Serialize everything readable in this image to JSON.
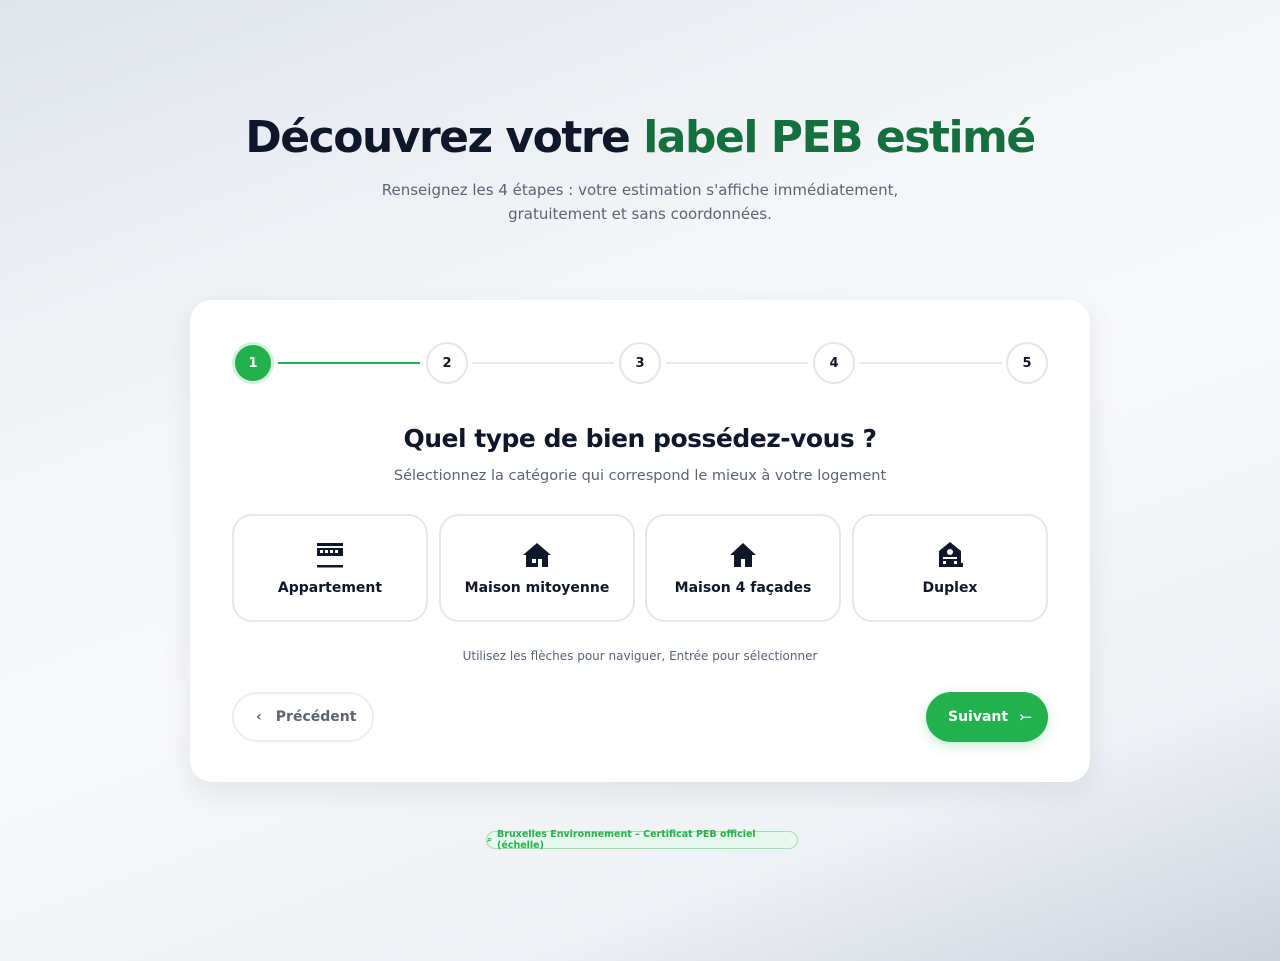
{
  "hero": {
    "title_main": "Découvrez votre ",
    "title_accent": "label PEB estimé",
    "subtitle_line1": "Renseignez les 4 étapes : votre estimation s'affiche immédiatement,",
    "subtitle_line2": "gratuitement et sans coordonnées."
  },
  "stepper": {
    "steps": [
      "1",
      "2",
      "3",
      "4",
      "5"
    ],
    "current_step": 1
  },
  "question": {
    "title": "Quel type de bien possédez-vous ?",
    "subtitle": "Sélectionnez la catégorie qui correspond le mieux à votre logement"
  },
  "options": [
    {
      "label": "Appartement",
      "icon": "apartment-icon"
    },
    {
      "label": "Maison mitoyenne",
      "icon": "terraced-house-icon"
    },
    {
      "label": "Maison 4 façades",
      "icon": "detached-house-icon"
    },
    {
      "label": "Duplex",
      "icon": "duplex-icon"
    }
  ],
  "hint": "Utilisez les flèches pour naviguer, Entrée pour sélectionner",
  "nav": {
    "prev_label": "Précédent",
    "next_label": "Suivant"
  },
  "footer": {
    "badge_text": "Bruxelles Environnement – Certificat PEB officiel (échelle)"
  },
  "colors": {
    "accent": "#22b14c",
    "accent_dark": "#166f3e",
    "text": "#0f172a",
    "muted": "#5b6474"
  }
}
